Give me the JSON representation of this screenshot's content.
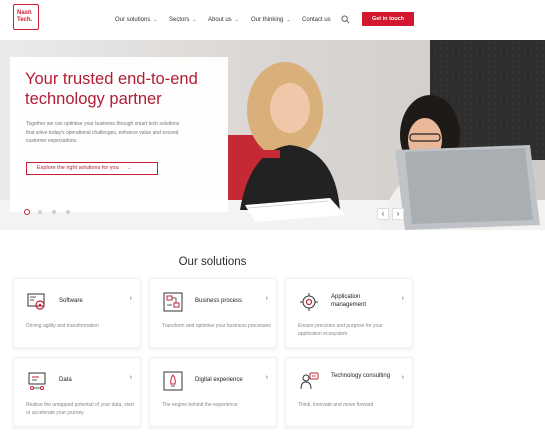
{
  "header": {
    "logo_line1": "Nash",
    "logo_line2": "Tech.",
    "nav": [
      {
        "label": "Our solutions",
        "has_menu": true
      },
      {
        "label": "Sectors",
        "has_menu": true
      },
      {
        "label": "About us",
        "has_menu": true
      },
      {
        "label": "Our thinking",
        "has_menu": true
      },
      {
        "label": "Contact us",
        "has_menu": false
      }
    ],
    "search_icon": "search-icon",
    "cta_label": "Get in touch"
  },
  "hero": {
    "title": "Your trusted end-to-end technology partner",
    "description": "Together we can optimise your business through smart tech solutions that solve today's operational challenges, enhance value and exceed customer expectations.",
    "button_label": "Explore the right solutions for you",
    "button_arrow": "→",
    "slides": 4,
    "active_slide": 1,
    "prev_glyph": "‹",
    "next_glyph": "›"
  },
  "solutions": {
    "title": "Our solutions",
    "cards": [
      {
        "title": "Software",
        "desc": "Driving agility and transformation",
        "icon": "software-icon"
      },
      {
        "title": "Business process",
        "desc": "Transform and optimise your business processes",
        "icon": "business-process-icon"
      },
      {
        "title": "Application management",
        "desc": "Ensure precision and purpose for your application ecosystem",
        "icon": "application-management-icon"
      },
      {
        "title": "Data",
        "desc": "Realise the untapped potential of your data, start or accelerate your journey",
        "icon": "data-icon"
      },
      {
        "title": "Digital experience",
        "desc": "The engine behind the experience",
        "icon": "digital-experience-icon"
      },
      {
        "title": "Technology consulting",
        "desc": "Think, innovate and move forward",
        "icon": "technology-consulting-icon"
      }
    ]
  },
  "colors": {
    "brand_red": "#d2172f",
    "title_red": "#b01d35"
  }
}
